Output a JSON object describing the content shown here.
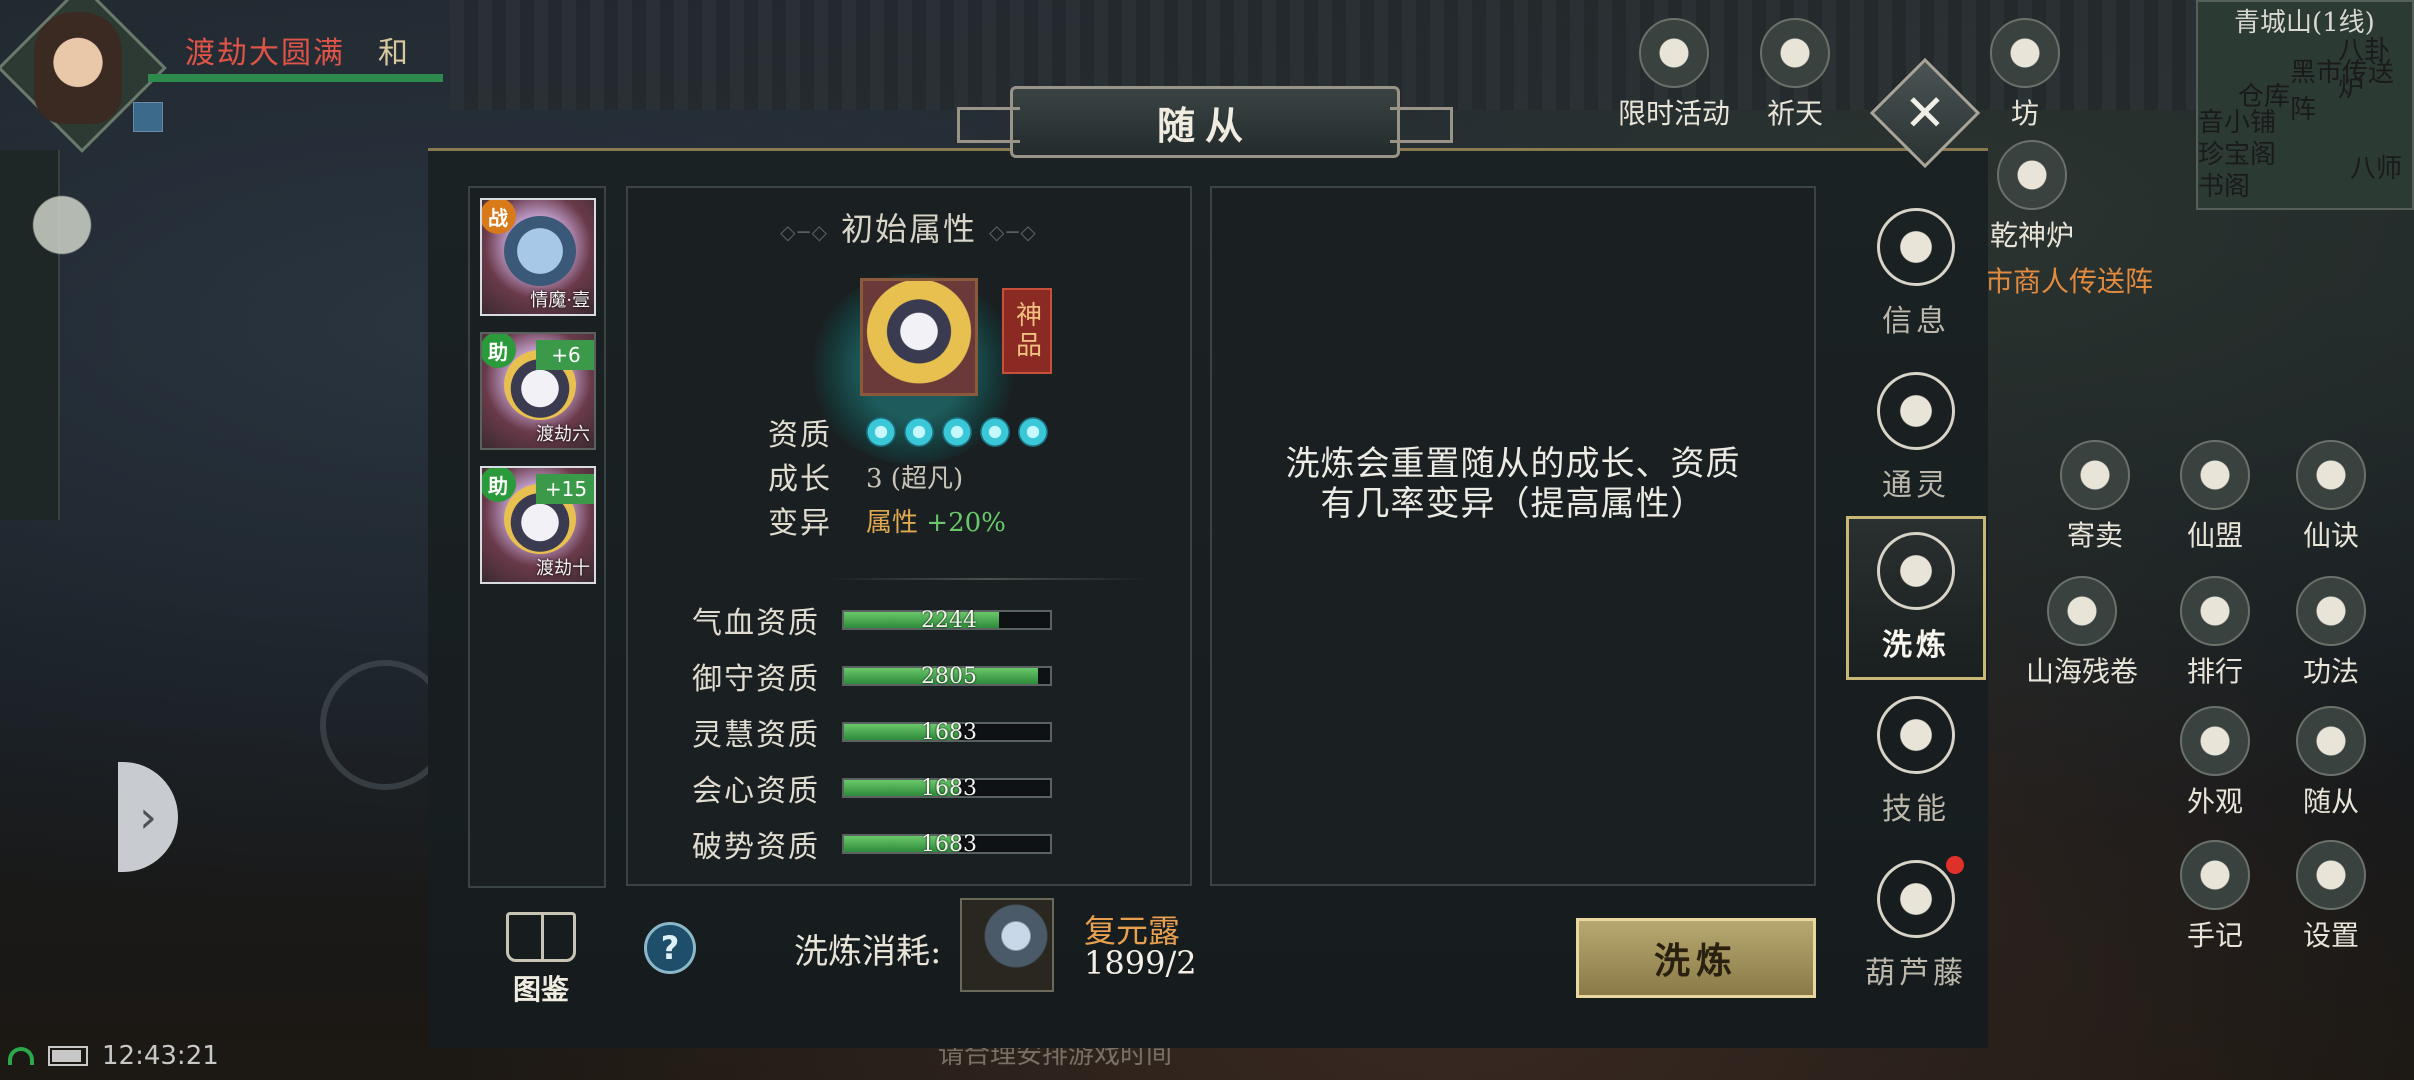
{
  "hud": {
    "player_name": "渡劫大圆满",
    "player_tag": "和",
    "time": "12:43:21",
    "bottom_tip": "请合理安排游戏时间",
    "top_icons": [
      "限时活动",
      "祈天"
    ],
    "minimap": {
      "area": "青城山(1线)",
      "places": [
        "黑市传送阵",
        "仓库",
        "八卦炉",
        "音小铺",
        "珍宝阁",
        "书阁",
        "八师"
      ]
    },
    "scene_label": "市商人传送阵",
    "right_icons": [
      "乾神炉",
      "寄卖",
      "仙盟",
      "仙诀",
      "山海残卷",
      "排行",
      "功法",
      "外观",
      "随从",
      "手记",
      "设置",
      "坊"
    ]
  },
  "dialog": {
    "title": "随从",
    "close": "✕",
    "pets": [
      {
        "name": "情魔·壹",
        "badge": "战",
        "level": ""
      },
      {
        "name": "渡劫六",
        "badge": "助",
        "level": "+6"
      },
      {
        "name": "渡劫十",
        "badge": "助",
        "level": "+15"
      }
    ],
    "stats": {
      "section_title": "初始属性",
      "grade": "神品",
      "aptitude_label": "资质",
      "aptitude_dots": 5,
      "growth_label": "成长",
      "growth_value": "3 (超凡)",
      "mutation_label": "变异",
      "mutation_attr": "属性",
      "mutation_bonus": "+20%",
      "bars": [
        {
          "label": "气血资质",
          "value": "2244",
          "fill": 0.75
        },
        {
          "label": "御守资质",
          "value": "2805",
          "fill": 0.94
        },
        {
          "label": "灵慧资质",
          "value": "1683",
          "fill": 0.56
        },
        {
          "label": "会心资质",
          "value": "1683",
          "fill": 0.56
        },
        {
          "label": "破势资质",
          "value": "1683",
          "fill": 0.56
        }
      ]
    },
    "info_line1": "洗炼会重置随从的成长、资质",
    "info_line2": "有几率变异（提高属性）",
    "bottom": {
      "atlas_label": "图鉴",
      "help": "?",
      "cost_label": "洗炼消耗:",
      "item_name": "复元露",
      "item_count": "1899/2",
      "refine_button": "洗炼"
    },
    "tabs": [
      {
        "label": "信息",
        "active": false
      },
      {
        "label": "通灵",
        "active": false
      },
      {
        "label": "洗炼",
        "active": true
      },
      {
        "label": "技能",
        "active": false
      },
      {
        "label": "葫芦藤",
        "active": false
      }
    ]
  }
}
